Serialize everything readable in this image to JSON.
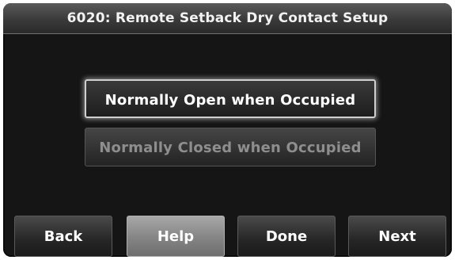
{
  "screen": {
    "title": "6020: Remote Setback Dry Contact Setup"
  },
  "options": [
    {
      "label": "Normally Open when Occupied",
      "selected": true
    },
    {
      "label": "Normally Closed when Occupied",
      "selected": false
    }
  ],
  "nav": {
    "back_label": "Back",
    "help_label": "Help",
    "done_label": "Done",
    "next_label": "Next"
  },
  "colors": {
    "background": "#151515",
    "title_bar": "#3a3a3a",
    "selected_border": "#cfcfcf",
    "unselected_text": "#8e8e8e",
    "help_button": "#848484"
  }
}
